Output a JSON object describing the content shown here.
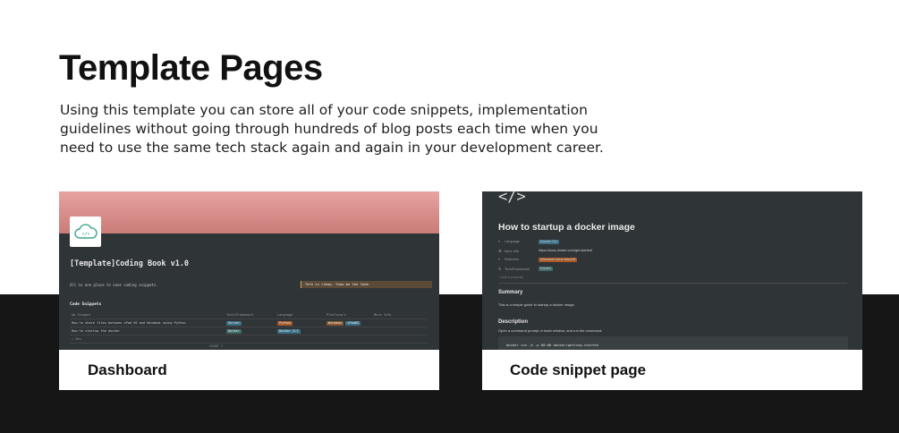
{
  "page": {
    "title": "Template Pages",
    "description": "Using this template you can store all of your code snippets, implementation guidelines without going through hundreds of blog posts each time when you need to use the same tech stack again and again in your development career."
  },
  "cards": {
    "dashboard": {
      "caption": "Dashboard",
      "logo_glyph": "</>",
      "title": "[Template]Coding Book v1.0",
      "description": "All in one place to save coding snippets.",
      "callout": "Talk is cheap. Show me the Code.",
      "database_title": "Code Snippets",
      "columns": [
        "Aa Snippet",
        "Tech/Framework",
        "Language",
        "Platform/s",
        "More Info"
      ],
      "rows": [
        {
          "snippet": "How to share files between iPad OS and Windows using Python",
          "tech": "Server",
          "language": "Python",
          "platforms": [
            "Windows",
            "iPadOS"
          ]
        },
        {
          "snippet": "How to startup the docker",
          "tech": "Docker",
          "language": "Docker CLI",
          "platforms": []
        }
      ],
      "new_label": "+ New",
      "count_label": "COUNT 2"
    },
    "snippet": {
      "caption": "Code snippet page",
      "icon_glyph": "</>",
      "title": "How to startup a docker image",
      "properties": [
        {
          "name": "Language",
          "value": "Docker CLI"
        },
        {
          "name": "More Info",
          "value": "https://docs.docker.com/get-started/"
        },
        {
          "name": "Platforms",
          "value": "Windows Linux MacOS"
        },
        {
          "name": "Tech/Framework",
          "value": "Docker"
        }
      ],
      "add_property": "+ Add a property",
      "summary_heading": "Summary",
      "summary_text": "This is a simple guide to startup a docker image.",
      "description_heading": "Description",
      "description_text": "Open a command prompt or bash window, and run the command:",
      "code": "docker run -d -p 80:80 docker/getting-started"
    }
  },
  "colors": {
    "background_top": "#ffffff",
    "background_band": "#161616",
    "screenshot_dark": "#2f3437",
    "cover_gradient_start": "#e8a3a0",
    "cover_gradient_end": "#c97b78"
  }
}
